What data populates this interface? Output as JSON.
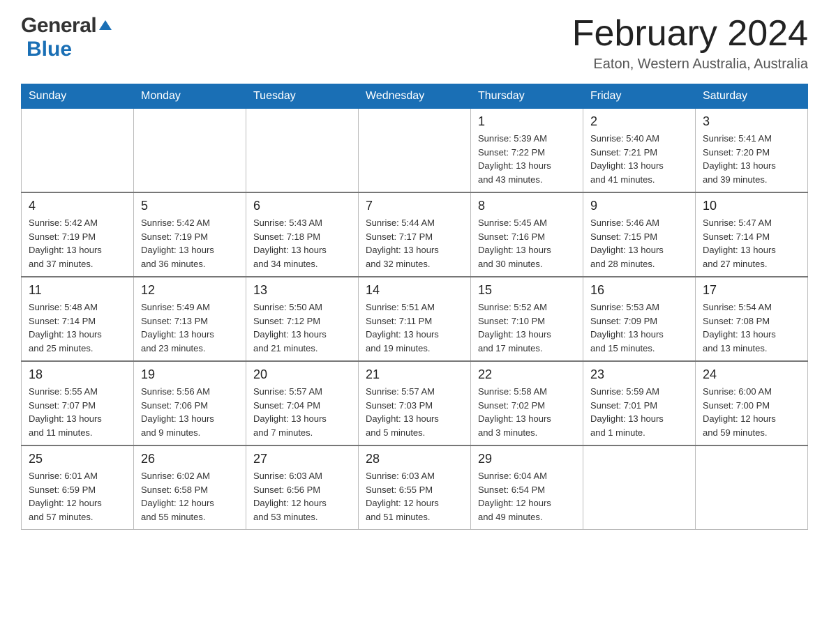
{
  "header": {
    "logo_general": "General",
    "logo_blue": "Blue",
    "month_title": "February 2024",
    "location": "Eaton, Western Australia, Australia"
  },
  "days_of_week": [
    "Sunday",
    "Monday",
    "Tuesday",
    "Wednesday",
    "Thursday",
    "Friday",
    "Saturday"
  ],
  "weeks": [
    {
      "days": [
        {
          "number": "",
          "info": ""
        },
        {
          "number": "",
          "info": ""
        },
        {
          "number": "",
          "info": ""
        },
        {
          "number": "",
          "info": ""
        },
        {
          "number": "1",
          "info": "Sunrise: 5:39 AM\nSunset: 7:22 PM\nDaylight: 13 hours\nand 43 minutes."
        },
        {
          "number": "2",
          "info": "Sunrise: 5:40 AM\nSunset: 7:21 PM\nDaylight: 13 hours\nand 41 minutes."
        },
        {
          "number": "3",
          "info": "Sunrise: 5:41 AM\nSunset: 7:20 PM\nDaylight: 13 hours\nand 39 minutes."
        }
      ]
    },
    {
      "days": [
        {
          "number": "4",
          "info": "Sunrise: 5:42 AM\nSunset: 7:19 PM\nDaylight: 13 hours\nand 37 minutes."
        },
        {
          "number": "5",
          "info": "Sunrise: 5:42 AM\nSunset: 7:19 PM\nDaylight: 13 hours\nand 36 minutes."
        },
        {
          "number": "6",
          "info": "Sunrise: 5:43 AM\nSunset: 7:18 PM\nDaylight: 13 hours\nand 34 minutes."
        },
        {
          "number": "7",
          "info": "Sunrise: 5:44 AM\nSunset: 7:17 PM\nDaylight: 13 hours\nand 32 minutes."
        },
        {
          "number": "8",
          "info": "Sunrise: 5:45 AM\nSunset: 7:16 PM\nDaylight: 13 hours\nand 30 minutes."
        },
        {
          "number": "9",
          "info": "Sunrise: 5:46 AM\nSunset: 7:15 PM\nDaylight: 13 hours\nand 28 minutes."
        },
        {
          "number": "10",
          "info": "Sunrise: 5:47 AM\nSunset: 7:14 PM\nDaylight: 13 hours\nand 27 minutes."
        }
      ]
    },
    {
      "days": [
        {
          "number": "11",
          "info": "Sunrise: 5:48 AM\nSunset: 7:14 PM\nDaylight: 13 hours\nand 25 minutes."
        },
        {
          "number": "12",
          "info": "Sunrise: 5:49 AM\nSunset: 7:13 PM\nDaylight: 13 hours\nand 23 minutes."
        },
        {
          "number": "13",
          "info": "Sunrise: 5:50 AM\nSunset: 7:12 PM\nDaylight: 13 hours\nand 21 minutes."
        },
        {
          "number": "14",
          "info": "Sunrise: 5:51 AM\nSunset: 7:11 PM\nDaylight: 13 hours\nand 19 minutes."
        },
        {
          "number": "15",
          "info": "Sunrise: 5:52 AM\nSunset: 7:10 PM\nDaylight: 13 hours\nand 17 minutes."
        },
        {
          "number": "16",
          "info": "Sunrise: 5:53 AM\nSunset: 7:09 PM\nDaylight: 13 hours\nand 15 minutes."
        },
        {
          "number": "17",
          "info": "Sunrise: 5:54 AM\nSunset: 7:08 PM\nDaylight: 13 hours\nand 13 minutes."
        }
      ]
    },
    {
      "days": [
        {
          "number": "18",
          "info": "Sunrise: 5:55 AM\nSunset: 7:07 PM\nDaylight: 13 hours\nand 11 minutes."
        },
        {
          "number": "19",
          "info": "Sunrise: 5:56 AM\nSunset: 7:06 PM\nDaylight: 13 hours\nand 9 minutes."
        },
        {
          "number": "20",
          "info": "Sunrise: 5:57 AM\nSunset: 7:04 PM\nDaylight: 13 hours\nand 7 minutes."
        },
        {
          "number": "21",
          "info": "Sunrise: 5:57 AM\nSunset: 7:03 PM\nDaylight: 13 hours\nand 5 minutes."
        },
        {
          "number": "22",
          "info": "Sunrise: 5:58 AM\nSunset: 7:02 PM\nDaylight: 13 hours\nand 3 minutes."
        },
        {
          "number": "23",
          "info": "Sunrise: 5:59 AM\nSunset: 7:01 PM\nDaylight: 13 hours\nand 1 minute."
        },
        {
          "number": "24",
          "info": "Sunrise: 6:00 AM\nSunset: 7:00 PM\nDaylight: 12 hours\nand 59 minutes."
        }
      ]
    },
    {
      "days": [
        {
          "number": "25",
          "info": "Sunrise: 6:01 AM\nSunset: 6:59 PM\nDaylight: 12 hours\nand 57 minutes."
        },
        {
          "number": "26",
          "info": "Sunrise: 6:02 AM\nSunset: 6:58 PM\nDaylight: 12 hours\nand 55 minutes."
        },
        {
          "number": "27",
          "info": "Sunrise: 6:03 AM\nSunset: 6:56 PM\nDaylight: 12 hours\nand 53 minutes."
        },
        {
          "number": "28",
          "info": "Sunrise: 6:03 AM\nSunset: 6:55 PM\nDaylight: 12 hours\nand 51 minutes."
        },
        {
          "number": "29",
          "info": "Sunrise: 6:04 AM\nSunset: 6:54 PM\nDaylight: 12 hours\nand 49 minutes."
        },
        {
          "number": "",
          "info": ""
        },
        {
          "number": "",
          "info": ""
        }
      ]
    }
  ]
}
